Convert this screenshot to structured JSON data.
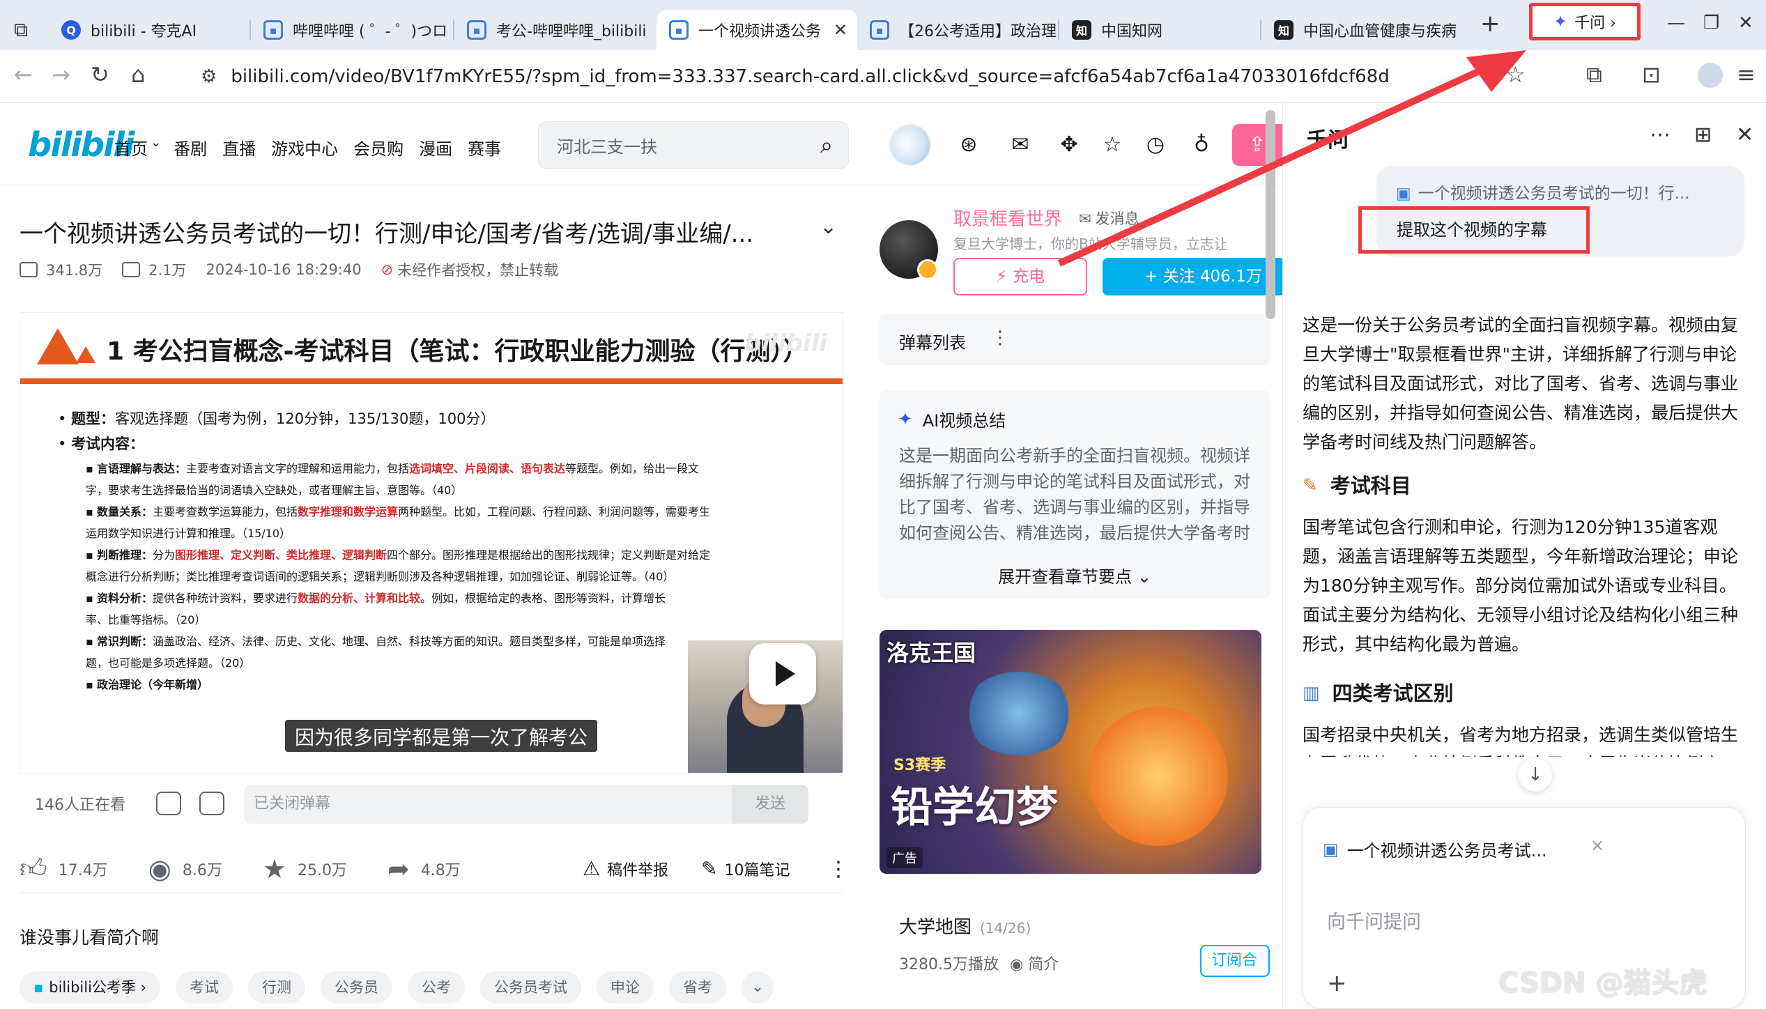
{
  "browser": {
    "tabs": [
      {
        "label": "bilibili - 夸克AI",
        "icon": "quark-ai-icon"
      },
      {
        "label": "哔哩哔哩 ( ゜- ゜)つロ",
        "icon": "bilibili-tv-icon"
      },
      {
        "label": "考公-哔哩哔哩_bilibili",
        "icon": "bilibili-tv-icon"
      },
      {
        "label": "一个视频讲透公务",
        "icon": "bilibili-tv-icon"
      },
      {
        "label": "【26公考适用】政治理",
        "icon": "bilibili-tv-icon"
      },
      {
        "label": "中国知网",
        "icon": "cnki-icon"
      },
      {
        "label": "中国心血管健康与疾病",
        "icon": "cnki-icon"
      }
    ],
    "ask_button": "千问 ›",
    "url": "bilibili.com/video/BV1f7mKYrE55/?spm_id_from=333.337.search-card.all.click&vd_source=afcf6a54ab7cf6a1a47033016fdcf68d"
  },
  "header": {
    "logo": "bilibili",
    "nav": [
      "首页",
      "番剧",
      "直播",
      "游戏中心",
      "会员购",
      "漫画",
      "赛事"
    ],
    "search_placeholder": "河北三支一扶"
  },
  "video": {
    "title": "一个视频讲透公务员考试的一切！行测/申论/国考/省考/选调/事业编/...",
    "plays": "341.8万",
    "danmaku_count": "2.1万",
    "date": "2024-10-16 18:29:40",
    "notice": "未经作者授权，禁止转载",
    "slide": {
      "title": "1 考公扫盲概念-考试科目（笔试：行政职业能力测验（行测））",
      "watermark": "bilibili",
      "line1_label": "题型：",
      "line1_text": "客观选择题（国考为例，120分钟，135/130题，100分）",
      "line2_label": "考试内容：",
      "items": [
        {
          "label": "言语理解与表达：",
          "text": "主要考查对语言文字的理解和运用能力，包括",
          "hl": "选词填空、片段阅读、语句表达",
          "rest": "等题型。例如，给出一段文字，要求考生选择最恰当的词语填入空缺处，或者理解主旨、意图等。（40）"
        },
        {
          "label": "数量关系：",
          "text": "主要考查数学运算能力，包括",
          "hl": "数字推理和数学运算",
          "rest": "两种题型。比如，工程问题、行程问题、利润问题等，需要考生运用数学知识进行计算和推理。（15/10）"
        },
        {
          "label": "判断推理：",
          "text": "分为",
          "hl": "图形推理、定义判断、类比推理、逻辑判断",
          "rest": "四个部分。图形推理是根据给出的图形找规律；定义判断是对给定概念进行分析判断；类比推理考查词语间的逻辑关系；逻辑判断则涉及各种逻辑推理，如加强论证、削弱论证等。（40）"
        },
        {
          "label": "资料分析：",
          "text": "提供各种统计资料，要求进行",
          "hl": "数据的分析、计算和比较",
          "rest": "。例如，根据给定的表格、图形等资料，计算增长率、比重等指标。（20）"
        },
        {
          "label": "常识判断：",
          "text": "涵盖政治、经济、法律、历史、文化、地理、自然、科技等方面的知识。题目类型多样，可能是单项选择题，也可能是多项选择题。（20）",
          "hl": "",
          "rest": ""
        },
        {
          "label": "政治理论（今年新增）",
          "text": "",
          "hl": "",
          "rest": ""
        }
      ]
    },
    "subtitle": "因为很多同学都是第一次了解考公",
    "viewers": "146人正在看",
    "danmaku_placeholder": "已关闭弹幕",
    "send": "发送",
    "likes": "17.4万",
    "coins": "8.6万",
    "favorites": "25.0万",
    "shares": "4.8万",
    "report": "稿件举报",
    "notes": "10篇笔记",
    "description": "谁没事儿看简介啊",
    "tags": [
      "bilibili公考季 ›",
      "考试",
      "行测",
      "公务员",
      "公考",
      "公务员考试",
      "申论",
      "省考"
    ]
  },
  "uploader": {
    "name": "取景框看世界",
    "message": "发消息",
    "desc": "复旦大学博士，你的B站大学辅导员，立志让",
    "charge": "充电",
    "follow": "+ 关注 406.1万"
  },
  "right_col": {
    "danmaku_list": "弹幕列表",
    "ai_summary_title": "AI视频总结",
    "ai_summary_text": "这是一期面向公考新手的全面扫盲视频。视频详细拆解了行测与申论的笔试科目及面试形式，对比了国考、省考、选调与事业编的区别，并指导如何查阅公告、精准选岗，最后提供大学备考时间线及",
    "expand": "展开查看章节要点 ⌄",
    "ad": {
      "brand": "洛克王国",
      "season": "S3赛季",
      "slogan": "铅学幻梦",
      "tag": "广告"
    },
    "list_title": "大学地图",
    "list_progress": "(14/26)",
    "list_plays": "3280.5万播放",
    "list_intro": "简介",
    "subscribe": "订阅合"
  },
  "side": {
    "title": "千问",
    "ref_video": "一个视频讲透公务员考试的一切！行...",
    "question": "提取这个视频的字幕",
    "answer_intro": "这是一份关于公务员考试的全面扫盲视频字幕。视频由复旦大学博士\"取景框看世界\"主讲，详细拆解了行测与申论的笔试科目及面试形式，对比了国考、省考、选调与事业编的区别，并指导如何查阅公告、精准选岗，最后提供大学备考时间线及热门问题解答。",
    "sec1_title": "考试科目",
    "sec1_text": "国考笔试包含行测和申论，行测为120分钟135道客观题，涵盖言语理解等五类题型，今年新增政治理论；申论为180分钟主观写作。部分岗位需加试外语或专业科目。面试主要分为结构化、无领导小组讨论及结构化小组三种形式，其中结构化最为普遍。",
    "sec2_title": "四类考试区别",
    "sec2_text": "国考招录中央机关，省考为地方招录，选调生类似管培生有晋升优势，事业编侧重科教文卫。应届生岗位比例高，但大部分要求本科以上，完间选调门槛极高且限特定高",
    "composer_chip": "一个视频讲透公务员考试...",
    "composer_placeholder": "向千问提问"
  },
  "watermark": "CSDN @猫头虎",
  "colors": {
    "accent_red": "#ee3b42",
    "bili_pink": "#fb7299",
    "bili_blue": "#00aeec",
    "slide_orange": "#e35a1d"
  }
}
